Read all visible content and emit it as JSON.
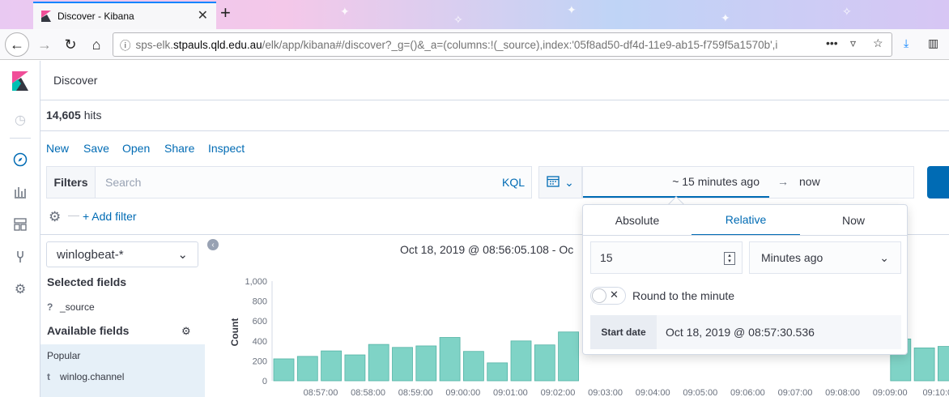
{
  "browser": {
    "tab_title": "Discover - Kibana",
    "url_prefix": "sps-elk.",
    "url_host": "stpauls.qld.edu.au",
    "url_rest": "/elk/app/kibana#/discover?_g=()&_a=(columns:!(_source),index:'05f8ad50-df4d-11e9-ab15-f759f5a1570b',i"
  },
  "header": {
    "breadcrumb": "Discover"
  },
  "hits": {
    "count": "14,605",
    "label": "hits"
  },
  "menu": {
    "new": "New",
    "save": "Save",
    "open": "Open",
    "share": "Share",
    "inspect": "Inspect"
  },
  "filters": {
    "label": "Filters",
    "placeholder": "Search",
    "kql": "KQL",
    "add_filter": "+ Add filter"
  },
  "time": {
    "start": "~ 15 minutes ago",
    "end": "now"
  },
  "sidebar": {
    "index_pattern": "winlogbeat-*",
    "selected_title": "Selected fields",
    "selected_fields": [
      {
        "type": "?",
        "name": "_source"
      }
    ],
    "available_title": "Available fields",
    "popular_title": "Popular",
    "popular_fields": [
      {
        "type": "t",
        "name": "winlog.channel"
      }
    ]
  },
  "chart_title": "Oct 18, 2019 @ 08:56:05.108 - Oc",
  "popover": {
    "tabs": [
      "Absolute",
      "Relative",
      "Now"
    ],
    "active_tab": "Relative",
    "value": "15",
    "unit": "Minutes ago",
    "round_label": "Round to the minute",
    "start_label": "Start date",
    "start_value": "Oct 18, 2019 @ 08:57:30.536"
  },
  "colors": {
    "accent": "#006bb4",
    "bar": "#7fd3c6"
  },
  "chart_data": {
    "type": "bar",
    "ylabel": "Count",
    "ylim": [
      0,
      1000
    ],
    "y_ticks": [
      "1,000",
      "800",
      "600",
      "400",
      "200",
      "0"
    ],
    "x_ticks": [
      "08:57:00",
      "08:58:00",
      "08:59:00",
      "09:00:00",
      "09:01:00",
      "09:02:00",
      "09:03:00",
      "09:04:00",
      "09:05:00",
      "09:06:00",
      "09:07:00",
      "09:08:00",
      "09:09:00",
      "09:10:0"
    ],
    "values": [
      220,
      245,
      300,
      260,
      365,
      335,
      350,
      435,
      295,
      180,
      400,
      360,
      490,
      0,
      0,
      0,
      0,
      0,
      0,
      0,
      0,
      0,
      0,
      0,
      0,
      0,
      420,
      330,
      345
    ]
  }
}
